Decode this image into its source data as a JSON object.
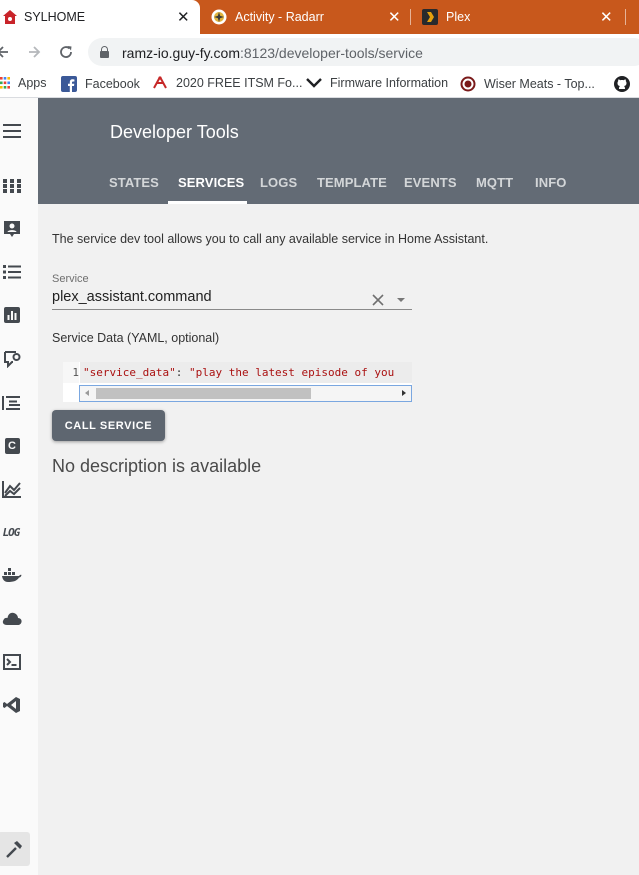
{
  "browser": {
    "tabs": [
      {
        "title": "SYLHOME",
        "close": "✕"
      },
      {
        "title": "Activity - Radarr",
        "close": "✕"
      },
      {
        "title": "Plex",
        "close": "✕"
      }
    ],
    "url_host": "ramz-io.guy-fy.com",
    "url_path": ":8123/developer-tools/service",
    "bookmarks": [
      {
        "label": "Apps"
      },
      {
        "label": "Facebook"
      },
      {
        "label": "2020 FREE ITSM Fo..."
      },
      {
        "label": "Firmware Information"
      },
      {
        "label": "Wiser Meats - Top..."
      }
    ]
  },
  "header": {
    "title": "Developer Tools",
    "tabs": [
      {
        "label": "STATES"
      },
      {
        "label": "SERVICES"
      },
      {
        "label": "LOGS"
      },
      {
        "label": "TEMPLATE"
      },
      {
        "label": "EVENTS"
      },
      {
        "label": "MQTT"
      },
      {
        "label": "INFO"
      }
    ],
    "active_tab": "SERVICES"
  },
  "sidebar": {
    "log_label": "LOG",
    "c_label": "C"
  },
  "service_tool": {
    "intro": "The service dev tool allows you to call any available service in Home Assistant.",
    "service_label": "Service",
    "service_value": "plex_assistant.command",
    "yaml_label": "Service Data (YAML, optional)",
    "editor": {
      "line_number": "1",
      "key": "\"service_data\"",
      "colon": ": ",
      "value": "\"play the latest episode of you"
    },
    "call_button": "CALL SERVICE",
    "description": "No description is available"
  },
  "colors": {
    "chrome_tabstrip": "#c8581c",
    "header_bg": "#636b75",
    "button_bg": "#5e6670",
    "content_bg": "#f1f1f1"
  }
}
